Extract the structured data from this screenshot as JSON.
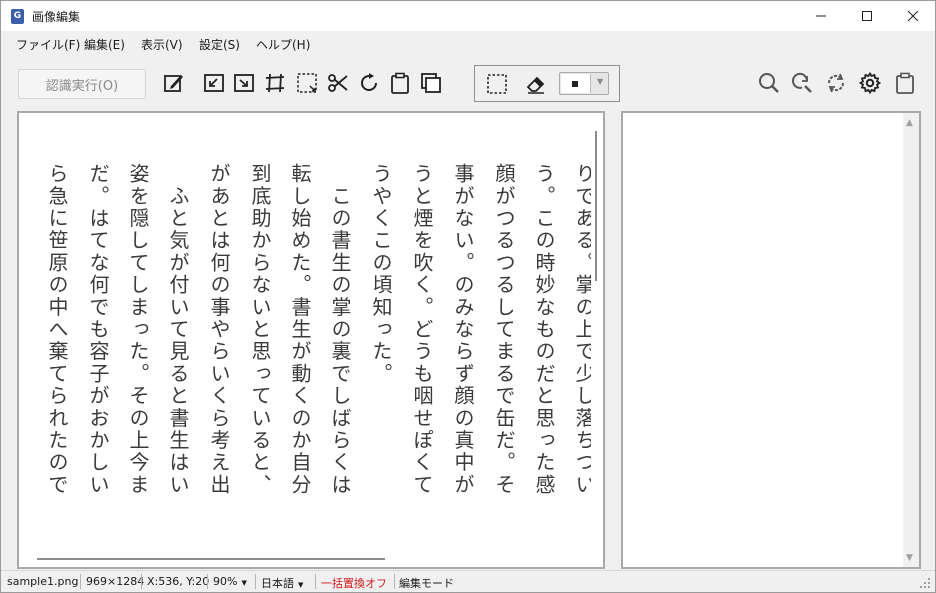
{
  "window": {
    "title": "画像編集",
    "icon_label": "G",
    "controls": [
      "minimize-icon",
      "maximize-icon",
      "close-icon"
    ]
  },
  "menu": [
    {
      "label": "ファイル(F)"
    },
    {
      "label": "編集(E)"
    },
    {
      "label": "表示(V)"
    },
    {
      "label": "設定(S)"
    },
    {
      "label": "ヘルプ(H)"
    }
  ],
  "toolbar": {
    "recognize_label": "認識実行(O)",
    "tools": [
      "edit-icon",
      "crop-left-icon",
      "crop-right-icon",
      "skew-icon",
      "select-resize-icon",
      "cut-icon",
      "rotate-icon",
      "paste-icon",
      "copy-icon"
    ],
    "group_tools": [
      "rect-select-icon",
      "eraser-icon"
    ],
    "right_tools": [
      "zoom-icon",
      "zoom-reset-icon",
      "refresh-icon",
      "gear-icon",
      "clipboard-icon"
    ]
  },
  "image_text_columns": [
    "りである。掌の上で少し落ちつい",
    "う。この時妙なものだと思った感",
    "顔がつるつるしてまるで缶だ。そ",
    "事がない。のみならず顔の真中が",
    "うと煙を吹く。どうも咽せぽくて",
    "うやくこの頃知った。",
    "　この書生の掌の裏でしばらくは",
    "転し始めた。書生が動くのか自分",
    "到底助からないと思っていると、",
    "があとは何の事やらいくら考え出",
    "　ふと気が付いて見ると書生はい",
    "姿を隠してしまった。その上今ま",
    "だ。はてな何でも容子がおかしい",
    "ら急に笹原の中へ棄てられたので"
  ],
  "colors": {
    "accent_red": "#d11a1a",
    "pane_border": "#a9a9a9",
    "background": "#f0f0f0"
  },
  "status": {
    "filename": "sample1.png",
    "dimensions": "969×1284",
    "coords": "X:536, Y:20",
    "zoom": "90%",
    "language": "日本語",
    "replace_mode": "一括置換オフ",
    "mode": "編集モード"
  }
}
